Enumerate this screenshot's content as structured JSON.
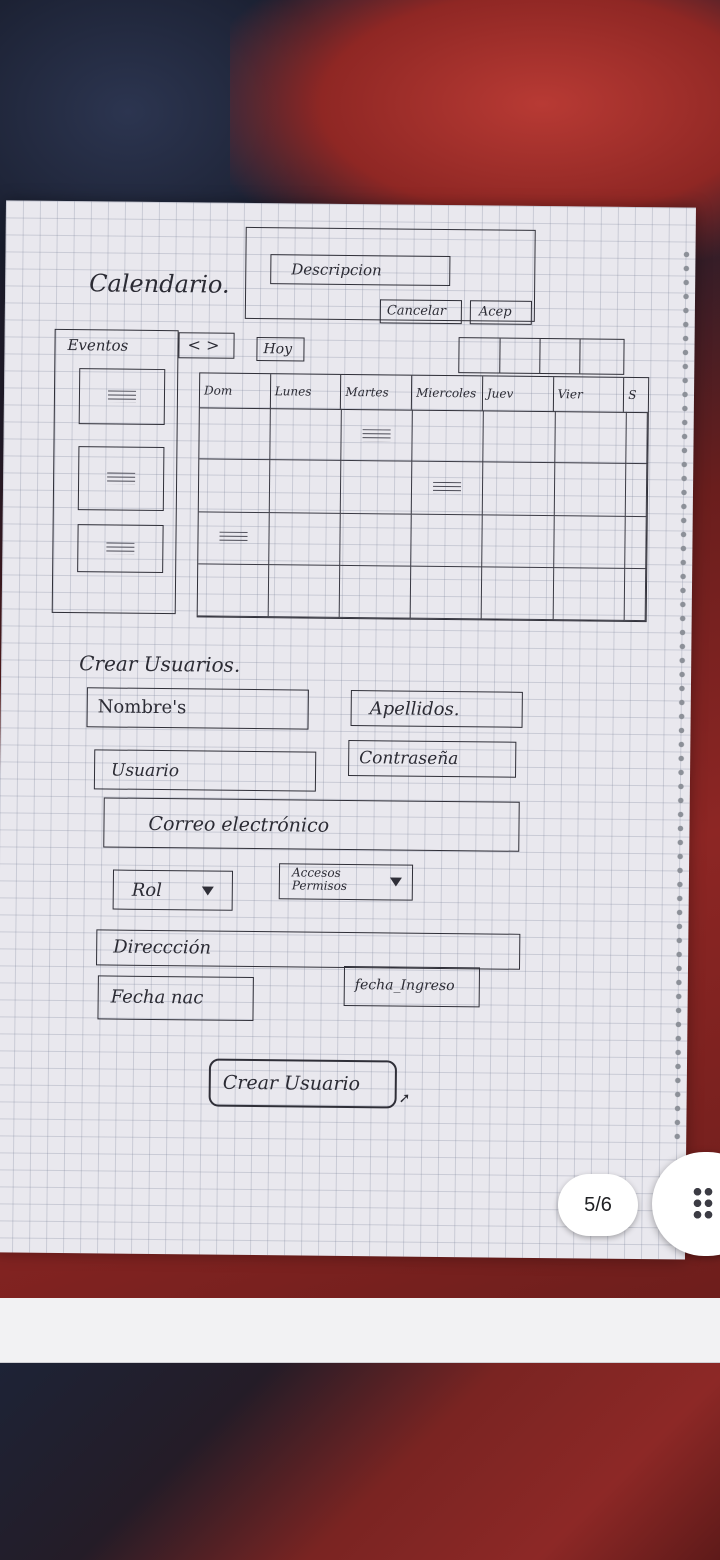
{
  "calendar": {
    "title": "Calendario.",
    "description_label": "Descripcion",
    "cancel_label": "Cancelar",
    "accept_label": "Acep",
    "events_label": "Eventos",
    "nav_label": "< >",
    "today_label": "Hoy",
    "days": [
      "Dom",
      "Lunes",
      "Martes",
      "Miercoles",
      "Juev",
      "Vier",
      "S"
    ]
  },
  "user_form": {
    "title": "Crear Usuarios.",
    "fields": {
      "nombres": "Nombre's",
      "apellidos": "Apellidos.",
      "usuario": "Usuario",
      "contrasena": "Contraseña",
      "correo": "Correo electrónico",
      "rol": "Rol",
      "accesos": "Accesos Permisos",
      "direccion": "Direccción",
      "fecha_nac": "Fecha nac",
      "fecha_ingreso": "fecha_Ingreso"
    },
    "submit_label": "Crear Usuario"
  },
  "viewer": {
    "page_indicator": "5/6",
    "menu_icon": "grid-dots-icon"
  }
}
